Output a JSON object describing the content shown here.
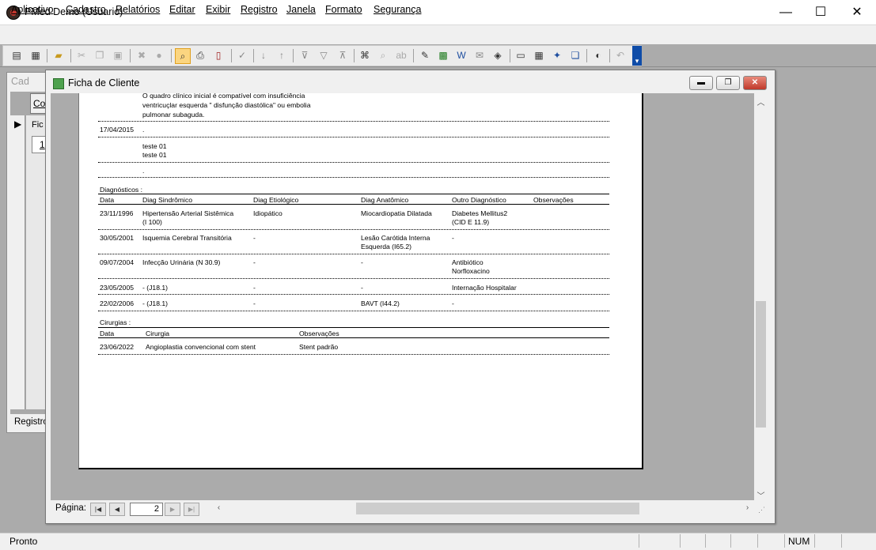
{
  "window": {
    "title": "PMed Demo (Usuario)",
    "minimize": "—",
    "maximize": "☐",
    "close": "✕"
  },
  "menu": [
    {
      "label": "Aplicativo"
    },
    {
      "label": "Cadastro"
    },
    {
      "label": "Relatórios"
    },
    {
      "label": "Editar"
    },
    {
      "label": "Exibir"
    },
    {
      "label": "Registro"
    },
    {
      "label": "Janela"
    },
    {
      "label": "Formato"
    },
    {
      "label": "Segurança"
    }
  ],
  "background_window": {
    "title": "Cad",
    "tab": "Co",
    "column": "Fic",
    "cell": "1",
    "footer": "Registro"
  },
  "ficha": {
    "title": "Ficha de Cliente",
    "intro_text": [
      "O quadro clínico inicial é compatível com insuficiência",
      "ventricuçlar esquerda \" disfunção diastólica\" ou embolia",
      "pulmonar subaguda."
    ],
    "entry_date": "17/04/2015",
    "entry_dot": ".",
    "entry_lines": [
      "teste 01",
      "teste 01"
    ],
    "dots_line": ".",
    "diagnosticos": {
      "heading": "Diagnósticos :",
      "headers": [
        "Data",
        "Diag Sindrômico",
        "Diag Etiológico",
        "Diag Anatômico",
        "Outro Diagnóstico",
        "Observações"
      ],
      "rows": [
        {
          "data": "23/11/1996",
          "sindromico": "Hipertensão Arterial Sistêmica",
          "sindromico2": "(I 100)",
          "etiologico": "Idiopático",
          "anatomico": "Miocardiopatia Dilatada",
          "anatomico2": "",
          "outro": "Diabetes Mellitus2",
          "outro2": "(CID E 11.9)"
        },
        {
          "data": "30/05/2001",
          "sindromico": "Isquemia Cerebral Transitória",
          "sindromico2": "",
          "etiologico": "-",
          "anatomico": "Lesão Carótida Interna",
          "anatomico2": "Esquerda (I65.2)",
          "outro": "-",
          "outro2": ""
        },
        {
          "data": "09/07/2004",
          "sindromico": "Infecção Urinária (N 30.9)",
          "sindromico2": "",
          "etiologico": "-",
          "anatomico": "-",
          "anatomico2": "",
          "outro": "Antibiótico",
          "outro2": "Norfloxacino"
        },
        {
          "data": "23/05/2005",
          "sindromico": "- (J18.1)",
          "sindromico2": "",
          "etiologico": "-",
          "anatomico": "-",
          "anatomico2": "",
          "outro": "Internação Hospitalar",
          "outro2": ""
        },
        {
          "data": "22/02/2006",
          "sindromico": "- (J18.1)",
          "sindromico2": "",
          "etiologico": "-",
          "anatomico": "BAVT (I44.2)",
          "anatomico2": "",
          "outro": "-",
          "outro2": ""
        }
      ]
    },
    "cirurgias": {
      "heading": "Cirurgias :",
      "headers": [
        "Data",
        "Cirurgia",
        "Observações"
      ],
      "rows": [
        {
          "data": "23/06/2022",
          "cirurgia": "Angioplastia convencional com stent",
          "obs": "Stent padrão"
        }
      ]
    },
    "nav": {
      "label": "Página:",
      "page": "2"
    }
  },
  "status": {
    "text": "Pronto",
    "num": "NUM"
  }
}
